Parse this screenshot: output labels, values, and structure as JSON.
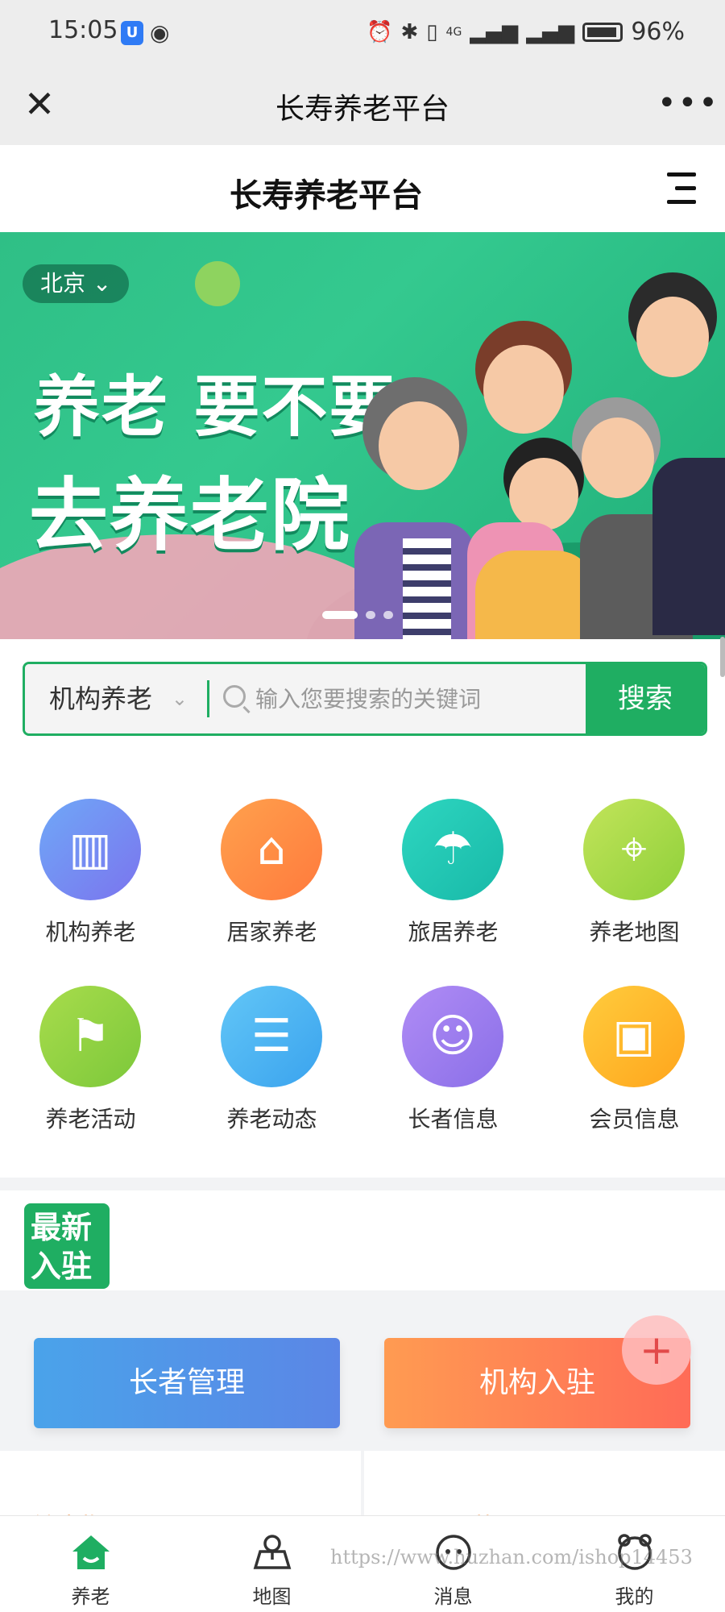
{
  "status_bar": {
    "time": "15:05",
    "network": "4G",
    "battery_pct": "96%"
  },
  "nav": {
    "title": "长寿养老平台",
    "close_label": "✕",
    "more_label": "•••"
  },
  "page": {
    "title": "长寿养老平台"
  },
  "banner": {
    "city": "北京",
    "headline_1": "养老 要不要",
    "headline_2": "去养老院",
    "slides": 3,
    "active_slide": 1,
    "colors": {
      "primary": "#2fbf86"
    }
  },
  "search": {
    "category": "机构养老",
    "placeholder": "输入您要搜索的关键词",
    "value": "",
    "button_label": "搜索",
    "accent": "#1fae62"
  },
  "grid": {
    "items": [
      {
        "label": "机构养老",
        "icon": "building-icon",
        "color": "#6f7ff0"
      },
      {
        "label": "居家养老",
        "icon": "home-heart-icon",
        "color": "#ff8a3d"
      },
      {
        "label": "旅居养老",
        "icon": "island-icon",
        "color": "#22c6b5"
      },
      {
        "label": "养老地图",
        "icon": "map-pin-icon",
        "color": "#a6d845"
      },
      {
        "label": "养老活动",
        "icon": "flag-icon",
        "color": "#8fd43f"
      },
      {
        "label": "养老动态",
        "icon": "news-icon",
        "color": "#46b4f5"
      },
      {
        "label": "长者信息",
        "icon": "elder-icon",
        "color": "#9a7ef0"
      },
      {
        "label": "会员信息",
        "icon": "member-card-icon",
        "color": "#ffb321"
      }
    ]
  },
  "latest": {
    "badge": "最新入驻"
  },
  "cards": {
    "elder_label": "长者管理",
    "org_label": "机构入驻",
    "plus_label": "+"
  },
  "peek": {
    "left": "健康指导",
    "right": "旺眠服范"
  },
  "tabs": [
    {
      "label": "养老",
      "icon": "home-icon",
      "active": true
    },
    {
      "label": "地图",
      "icon": "map-icon",
      "active": false
    },
    {
      "label": "消息",
      "icon": "message-icon",
      "active": false
    },
    {
      "label": "我的",
      "icon": "profile-icon",
      "active": false
    }
  ],
  "watermark": "https://www.huzhan.com/ishop14453"
}
